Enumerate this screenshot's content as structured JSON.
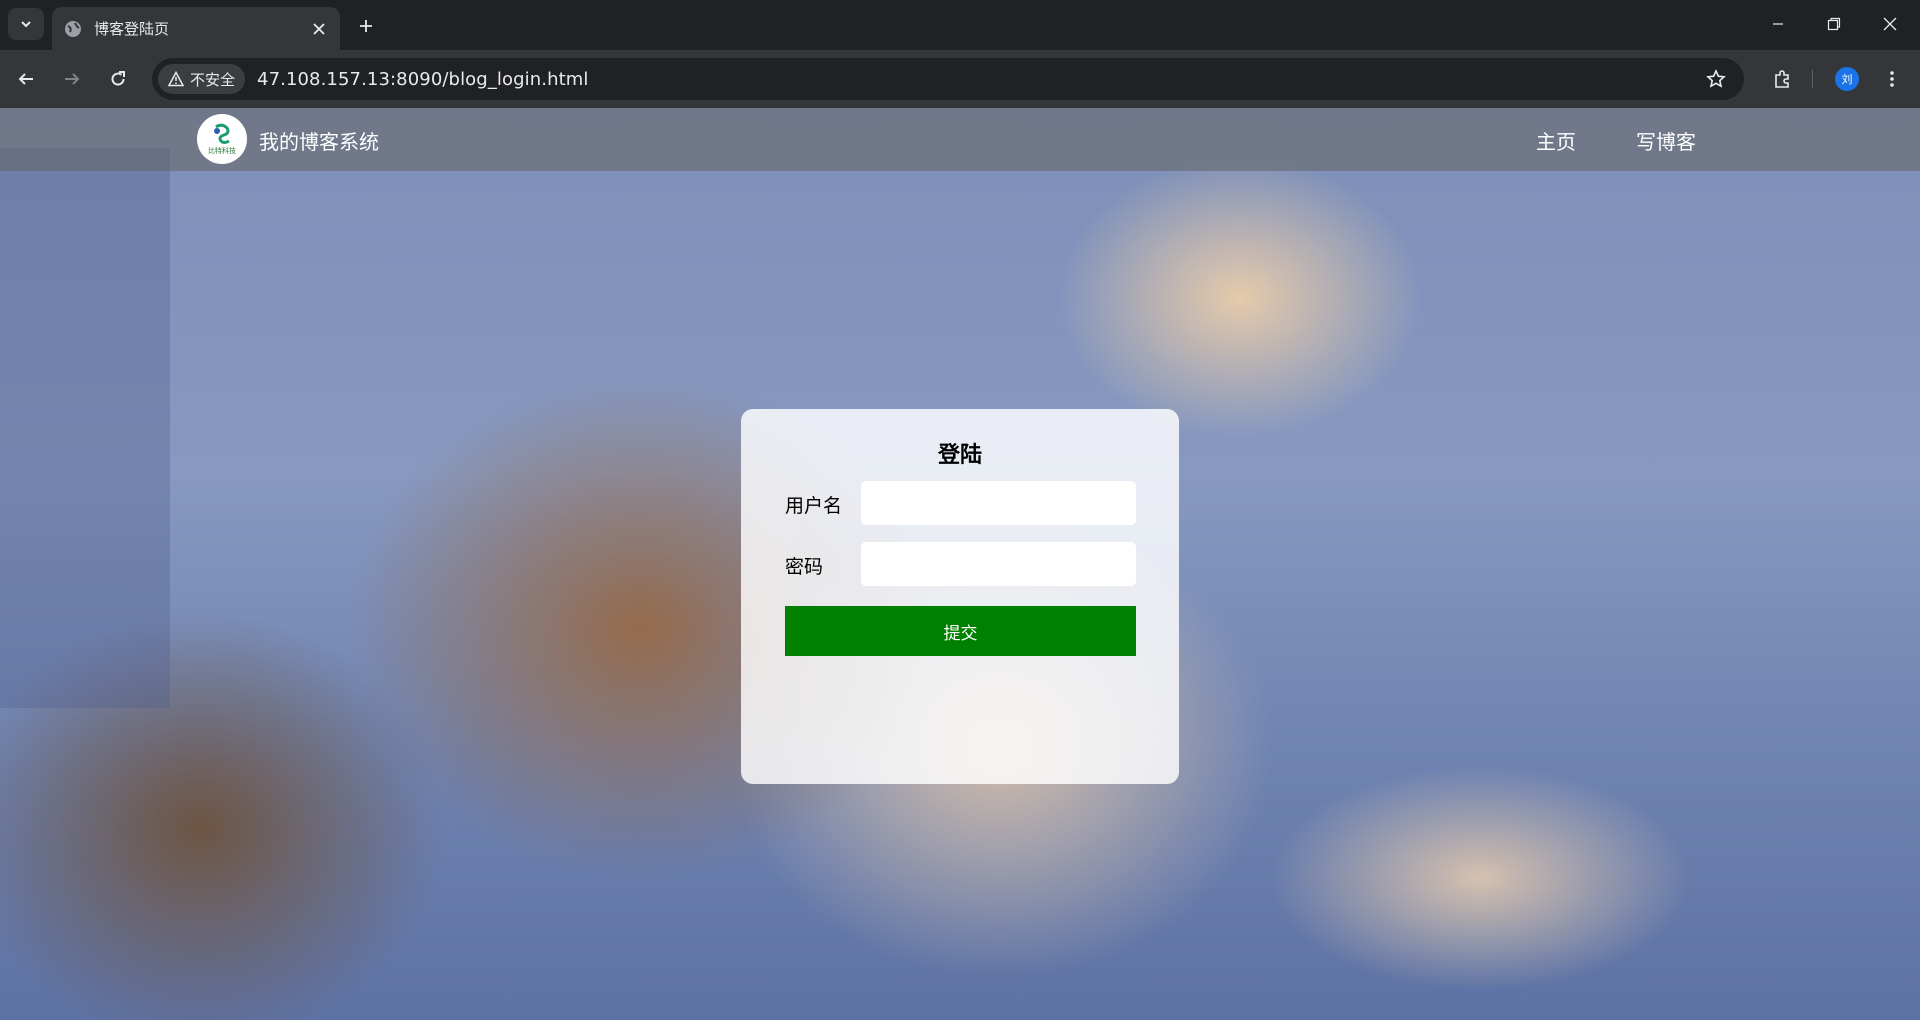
{
  "browser": {
    "tab_title": "博客登陆页",
    "security_label": "不安全",
    "url": "47.108.157.13:8090/blog_login.html",
    "profile_initial": "刘"
  },
  "header": {
    "logo_text": "比特科技",
    "site_title": "我的博客系统",
    "nav": {
      "home": "主页",
      "write": "写博客"
    }
  },
  "login": {
    "title": "登陆",
    "username_label": "用户名",
    "username_value": "",
    "password_label": "密码",
    "password_value": "",
    "submit_label": "提交"
  },
  "colors": {
    "submit_bg": "#008000",
    "header_bg": "#646464",
    "browser_dark": "#202124"
  }
}
